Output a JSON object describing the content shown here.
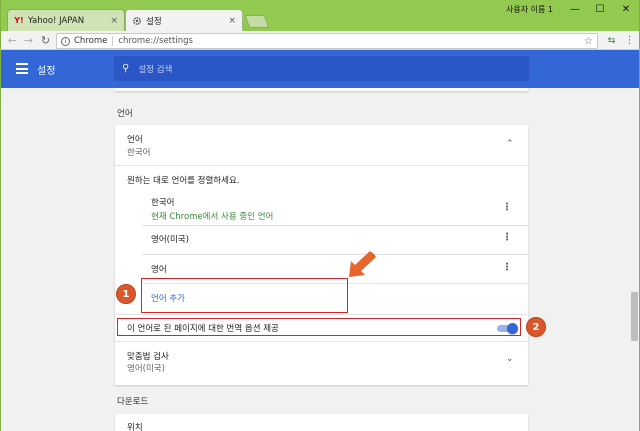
{
  "browser": {
    "tabs": [
      {
        "title": "Yahoo! JAPAN",
        "favicon": "Y!",
        "close": "×"
      },
      {
        "title": "설정",
        "favicon": "gear-icon",
        "close": "×"
      }
    ],
    "profile_name": "사용자 이름 1",
    "window_controls": {
      "minimize": "—",
      "maximize": "☐",
      "close": "✕"
    },
    "security_label": "Chrome",
    "url": "chrome://settings"
  },
  "header": {
    "title": "설정",
    "search_placeholder": "설정 검색"
  },
  "language_section": {
    "heading": "언어",
    "card_title": "언어",
    "card_value": "한국어",
    "order_hint": "원하는 대로 언어를 정렬하세요.",
    "languages": [
      {
        "name": "한국어",
        "note": "현재 Chrome에서 사용 중인 언어"
      },
      {
        "name": "영어(미국)",
        "note": ""
      },
      {
        "name": "영어",
        "note": ""
      }
    ],
    "add_language": "언어 추가",
    "translate_offer": "이 언어로 된 페이지에 대한 번역 옵션 제공",
    "translate_enabled": true
  },
  "spellcheck": {
    "title": "맞춤법 검사",
    "value": "영어(미국)"
  },
  "downloads_section": {
    "heading": "다운로드",
    "location_label": "위치"
  },
  "annotations": {
    "badge1": "1",
    "badge2": "2"
  },
  "colors": {
    "header_blue": "#3367d6",
    "frame_green": "#92c94f",
    "highlight_red": "#d0262c",
    "badge_orange": "#d9572b"
  }
}
